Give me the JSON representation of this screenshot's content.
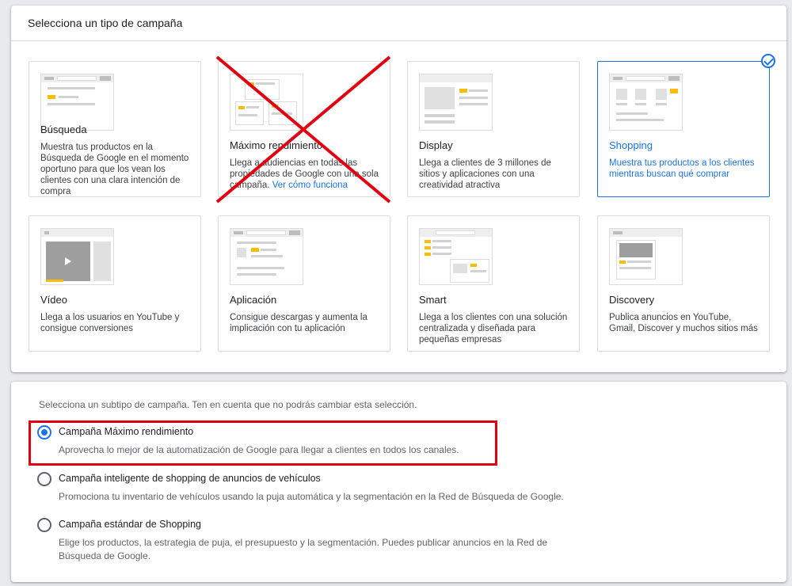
{
  "campaign_types": {
    "title": "Selecciona un tipo de campaña",
    "cards": [
      {
        "title": "Búsqueda",
        "desc": "Muestra tus productos en la Búsqueda de Google en el momento oportuno para que los vean los clientes con una clara intención de compra"
      },
      {
        "title": "Máximo rendimiento",
        "desc": "Llega a audiencias en todas las propiedades de Google con una sola campaña.",
        "link": "Ver cómo funciona"
      },
      {
        "title": "Display",
        "desc": "Llega a clientes de 3 millones de sitios y aplicaciones con una creatividad atractiva"
      },
      {
        "title": "Shopping",
        "desc": "Muestra tus productos a los clientes mientras buscan qué comprar"
      },
      {
        "title": "Vídeo",
        "desc": "Llega a los usuarios en YouTube y consigue conversiones"
      },
      {
        "title": "Aplicación",
        "desc": "Consigue descargas y aumenta la implicación con tu aplicación"
      },
      {
        "title": "Smart",
        "desc": "Llega a los clientes con una solución centralizada y diseñada para pequeñas empresas"
      },
      {
        "title": "Discovery",
        "desc": "Publica anuncios en YouTube, Gmail, Discover y muchos sitios más"
      }
    ]
  },
  "subtype": {
    "hint": "Selecciona un subtipo de campaña. Ten en cuenta que no podrás cambiar esta selección.",
    "options": [
      {
        "label": "Campaña Máximo rendimiento",
        "desc": "Aprovecha lo mejor de la automatización de Google para llegar a clientes en todos los canales.",
        "selected": true
      },
      {
        "label": "Campaña inteligente de shopping de anuncios de vehículos",
        "desc": "Promociona tu inventario de vehículos usando la puja automática y la segmentación en la Red de Búsqueda de Google.",
        "selected": false
      },
      {
        "label": "Campaña estándar de Shopping",
        "desc": "Elige los productos, la estrategia de puja, el presupuesto y la segmentación. Puedes publicar anuncios en la Red de Búsqueda de Google.",
        "selected": false
      }
    ]
  },
  "colors": {
    "accent": "#1a73e8",
    "annotation_red": "#e1000f",
    "highlight_yellow": "#fbbc04"
  }
}
